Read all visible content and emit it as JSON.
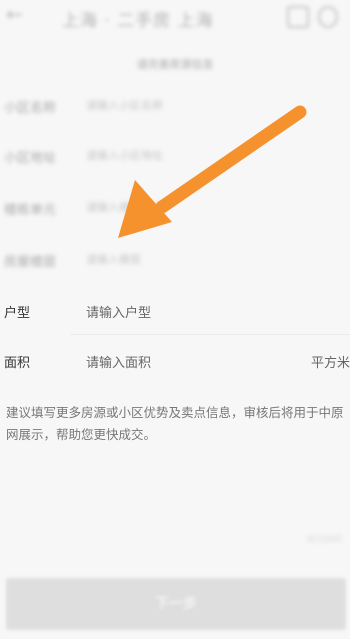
{
  "header": {
    "back_icon": "←",
    "title": "上海 · 二手房 上海",
    "icons": [
      "list-icon",
      "search-icon"
    ]
  },
  "subtitle": "请完善房源信息",
  "form": {
    "rows": [
      {
        "label": "小区名称",
        "value": "请输入小区名称"
      },
      {
        "label": "小区地址",
        "value": "请输入小区地址"
      },
      {
        "label": "楼栋单元",
        "value": "请输入楼栋单元"
      },
      {
        "label": "房屋楼层",
        "value": "请输入楼层"
      }
    ],
    "layout": {
      "label": "户型",
      "placeholder": "请输入户型"
    },
    "area": {
      "label": "面积",
      "placeholder": "请输入面积",
      "unit": "平方米"
    }
  },
  "description": "建议填写更多房源或小区优势及卖点信息，审核后将用于中原网展示，帮助您更快成交。",
  "counter": "0/1000",
  "next_button": "下一步",
  "arrow_color": "#f5922e"
}
